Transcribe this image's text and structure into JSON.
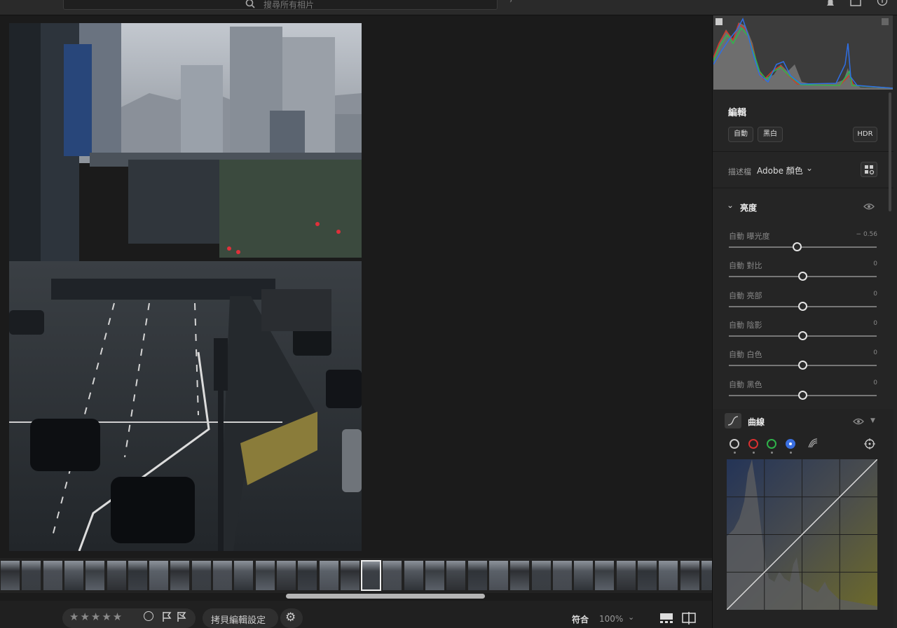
{
  "topbar": {
    "search_placeholder": "搜尋所有相片"
  },
  "bottombar": {
    "rating_stars": [
      "★",
      "★",
      "★",
      "★",
      "★"
    ],
    "copy_edit_label": "拷貝編輯設定",
    "fit_label": "符合",
    "zoom_value": "100%"
  },
  "edit_panel": {
    "title": "編輯",
    "auto_button": "自動",
    "bw_button": "黑白",
    "hdr_button": "HDR",
    "profile_label": "描述檔",
    "profile_value": "Adobe 顏色",
    "light_section": {
      "title": "亮度",
      "sliders": [
        {
          "label": "自動 曝光度",
          "value": "− 0.56",
          "position": 0.46
        },
        {
          "label": "自動 對比",
          "value": "0",
          "position": 0.5
        },
        {
          "label": "自動 亮部",
          "value": "0",
          "position": 0.5
        },
        {
          "label": "自動 陰影",
          "value": "0",
          "position": 0.5
        },
        {
          "label": "自動 白色",
          "value": "0",
          "position": 0.5
        },
        {
          "label": "自動 黑色",
          "value": "0",
          "position": 0.5
        }
      ]
    },
    "curve_section": {
      "title": "曲線",
      "channels": [
        "rgb",
        "red",
        "green",
        "blue"
      ],
      "active_channel": "blue"
    }
  },
  "filmstrip": {
    "selected_index": 17,
    "thumbnail_count": 34
  },
  "colors": {
    "panel_bg": "#252525",
    "canvas_bg": "#1b1b1b",
    "channel_red": "#d93030",
    "channel_green": "#2fb34a",
    "channel_blue": "#3a6fe0"
  },
  "icons": [
    "search-icon",
    "bell-icon",
    "window-icon",
    "help-icon",
    "chevron-down-icon",
    "eye-icon",
    "grid-browse-icon",
    "curve-icon",
    "target-adjust-icon",
    "gear-icon",
    "flag-icon",
    "circle-reject-icon",
    "compare-icon",
    "filmstrip-toggle-icon"
  ]
}
